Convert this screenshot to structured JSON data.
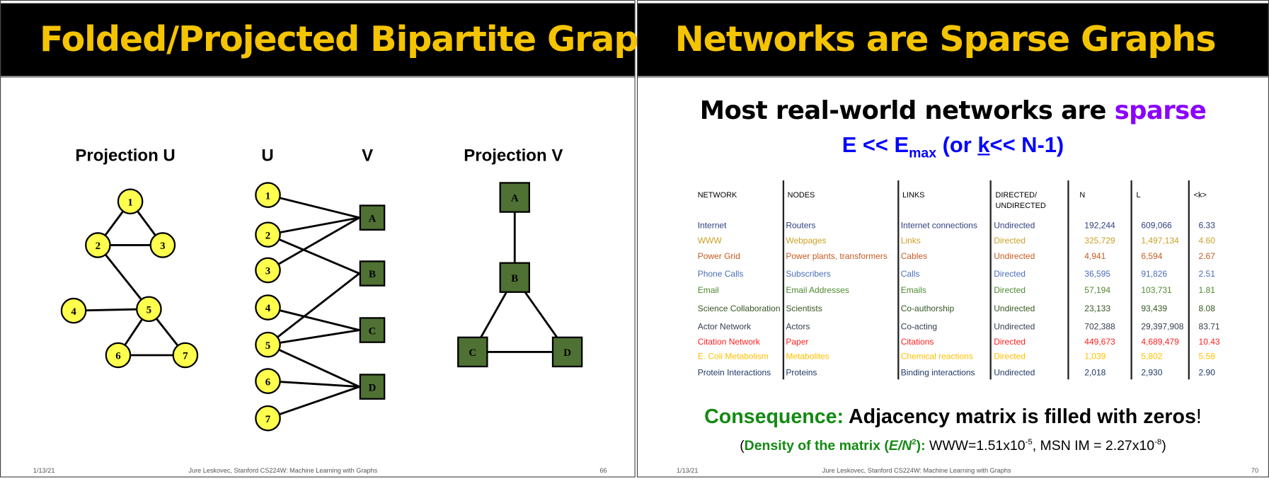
{
  "left_slide": {
    "title": "Folded/Projected Bipartite Graphs",
    "labels": {
      "projection_u": "Projection U",
      "u": "U",
      "v": "V",
      "projection_v": "Projection V"
    },
    "projection_u": {
      "nodes": [
        "1",
        "2",
        "3",
        "4",
        "5",
        "6",
        "7"
      ],
      "edges": [
        [
          "1",
          "2"
        ],
        [
          "1",
          "3"
        ],
        [
          "2",
          "3"
        ],
        [
          "2",
          "5"
        ],
        [
          "4",
          "5"
        ],
        [
          "5",
          "6"
        ],
        [
          "5",
          "7"
        ],
        [
          "6",
          "7"
        ]
      ]
    },
    "bipartite": {
      "u_nodes": [
        "1",
        "2",
        "3",
        "4",
        "5",
        "6",
        "7"
      ],
      "v_nodes": [
        "A",
        "B",
        "C",
        "D"
      ],
      "edges": [
        [
          "1",
          "A"
        ],
        [
          "2",
          "A"
        ],
        [
          "2",
          "B"
        ],
        [
          "3",
          "A"
        ],
        [
          "4",
          "C"
        ],
        [
          "5",
          "B"
        ],
        [
          "5",
          "C"
        ],
        [
          "5",
          "D"
        ],
        [
          "6",
          "D"
        ],
        [
          "7",
          "D"
        ]
      ]
    },
    "projection_v": {
      "nodes": [
        "A",
        "B",
        "C",
        "D"
      ],
      "edges": [
        [
          "A",
          "B"
        ],
        [
          "B",
          "C"
        ],
        [
          "B",
          "D"
        ],
        [
          "C",
          "D"
        ]
      ]
    },
    "colors": {
      "u_node": "#FFFF4D",
      "v_node": "#4F7133"
    },
    "footer": {
      "date": "1/13/21",
      "credit": "Jure Leskovec, Stanford CS224W: Machine Learning with Graphs",
      "page": "66"
    }
  },
  "right_slide": {
    "title": "Networks are Sparse Graphs",
    "headline": {
      "prefix": "Most real-world networks are ",
      "highlight": "sparse"
    },
    "formula": {
      "e": "E << ",
      "emax": "E",
      "emax_sub": "max",
      "paren_open": " (or ",
      "k": "k",
      "rest": "<< N-1)"
    },
    "table": {
      "headers": [
        "NETWORK",
        "NODES",
        "LINKS",
        "DIRECTED/\nUNDIRECTED",
        "N",
        "L",
        "<k>"
      ],
      "rows": [
        {
          "color": "#2F3F7F",
          "cells": [
            "Internet",
            "Routers",
            "Internet connections",
            "Undirected",
            "192,244",
            "609,066",
            "6.33"
          ]
        },
        {
          "color": "#C9A227",
          "cells": [
            "WWW",
            "Webpages",
            "Links",
            "Directed",
            "325,729",
            "1,497,134",
            "4.60"
          ]
        },
        {
          "color": "#C55A22",
          "cells": [
            "Power Grid",
            "Power plants, transformers",
            "Cables",
            "Undirected",
            "4,941",
            "6,594",
            "2.67"
          ]
        },
        {
          "color": "#4A6DB5",
          "cells": [
            "Phone Calls",
            "Subscribers",
            "Calls",
            "Directed",
            "36,595",
            "91,826",
            "2.51"
          ]
        },
        {
          "color": "#4E8A30",
          "cells": [
            "Email",
            "Email Addresses",
            "Emails",
            "Directed",
            "57,194",
            "103,731",
            "1.81"
          ]
        },
        {
          "color": "#375623",
          "cells": [
            "Science Collaboration",
            "Scientists",
            "Co-authorship",
            "Undirected",
            "23,133",
            "93,439",
            "8.08"
          ]
        },
        {
          "color": "#333F4F",
          "cells": [
            "Actor Network",
            "Actors",
            "Co-acting",
            "Undirected",
            "702,388",
            "29,397,908",
            "83.71"
          ]
        },
        {
          "color": "#FF2020",
          "cells": [
            "Citation Network",
            "Paper",
            "Citations",
            "Directed",
            "449,673",
            "4,689,479",
            "10.43"
          ]
        },
        {
          "color": "#FFC000",
          "cells": [
            "E. Coli Metabolism",
            "Metabolites",
            "Chemical reactions",
            "Directed",
            "1,039",
            "5,802",
            "5.58"
          ]
        },
        {
          "color": "#1F3864",
          "cells": [
            "Protein Interactions",
            "Proteins",
            "Binding interactions",
            "Undirected",
            "2,018",
            "2,930",
            "2.90"
          ]
        }
      ]
    },
    "consequence": {
      "label": "Consequence:",
      "text": " Adjacency matrix is filled with zeros",
      "bang": "!"
    },
    "density": {
      "open": "(",
      "label": "Density of the matrix (",
      "e_n": "E/N",
      "sq": "2",
      "close_label": "):",
      "www": " WWW=1.51x10",
      "www_exp": "-5",
      "msn": ", MSN IM = 2.27x10",
      "msn_exp": "-8",
      "close": ")"
    },
    "colors": {
      "title": "#F5C400",
      "sparse": "#8B00FF",
      "formula": "#0000FF",
      "consequence": "#138A13"
    },
    "footer": {
      "date": "1/13/21",
      "credit": "Jure Leskovec, Stanford CS224W: Machine Learning with Graphs",
      "page": "70"
    }
  }
}
